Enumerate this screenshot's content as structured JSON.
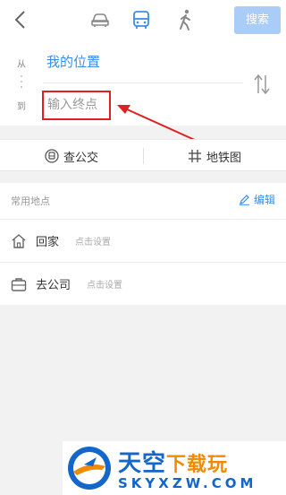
{
  "header": {
    "modes": [
      "car-icon",
      "bus-icon",
      "walk-icon"
    ],
    "active_mode": "bus-icon",
    "search_label": "搜索"
  },
  "route": {
    "from_label": "从",
    "to_label": "到",
    "from_value": "我的位置",
    "to_placeholder": "输入终点"
  },
  "actions": {
    "transit_label": "查公交",
    "metro_label": "地铁图"
  },
  "common_places": {
    "title": "常用地点",
    "edit_label": "编辑",
    "items": [
      {
        "name": "回家",
        "hint": "点击设置",
        "icon": "home-icon"
      },
      {
        "name": "去公司",
        "hint": "点击设置",
        "icon": "briefcase-icon"
      }
    ]
  },
  "watermark": {
    "title_main": "天空",
    "title_accent": "下载玩",
    "domain": "SKYXZW.COM"
  },
  "colors": {
    "accent_blue": "#3a8ee6",
    "search_button": "#a9cdf6",
    "annotation_red": "#e02020",
    "watermark_blue": "#1466c8",
    "watermark_orange": "#f08a00"
  }
}
